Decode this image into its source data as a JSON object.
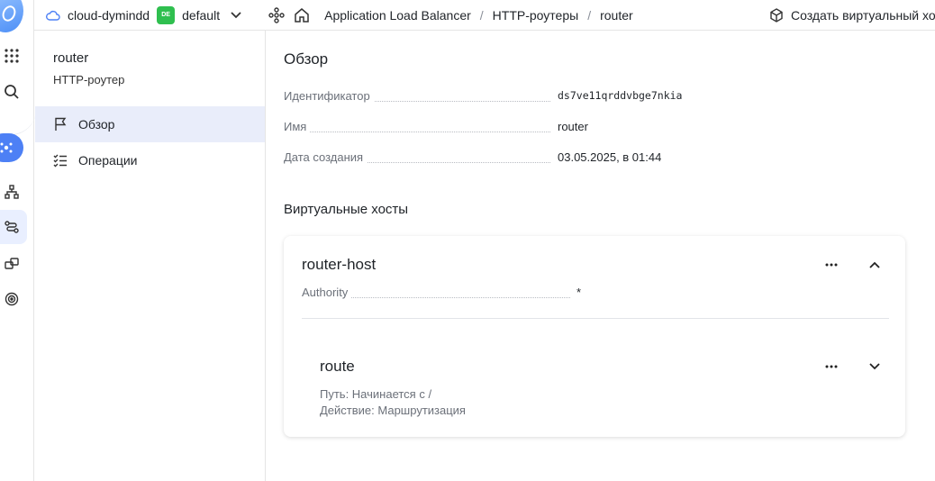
{
  "topbar": {
    "cloud": "cloud-dymindd",
    "folder_badge": "DE",
    "folder": "default",
    "breadcrumbs": [
      "Application Load Balancer",
      "HTTP-роутеры",
      "router"
    ],
    "create_button": "Создать виртуальный хост"
  },
  "sidebar": {
    "title": "router",
    "subtitle": "HTTP-роутер",
    "items": [
      {
        "label": "Обзор",
        "icon": "flag-icon",
        "active": true
      },
      {
        "label": "Операции",
        "icon": "list-check-icon",
        "active": false
      }
    ]
  },
  "overview": {
    "heading": "Обзор",
    "props": [
      {
        "key": "Идентификатор",
        "value": "ds7ve11qrddvbge7nkia"
      },
      {
        "key": "Имя",
        "value": "router"
      },
      {
        "key": "Дата создания",
        "value": "03.05.2025, в 01:44"
      }
    ]
  },
  "virtual_hosts": {
    "heading": "Виртуальные хосты",
    "host": {
      "name": "router-host",
      "authority_key": "Authority",
      "authority_value": "*",
      "route": {
        "name": "route",
        "path": "Путь: Начинается с /",
        "action": "Действие: Маршрутизация"
      }
    }
  },
  "colors": {
    "accent": "#4d80f5",
    "active_bg": "#e9edfa",
    "badge": "#2fbf4f"
  }
}
